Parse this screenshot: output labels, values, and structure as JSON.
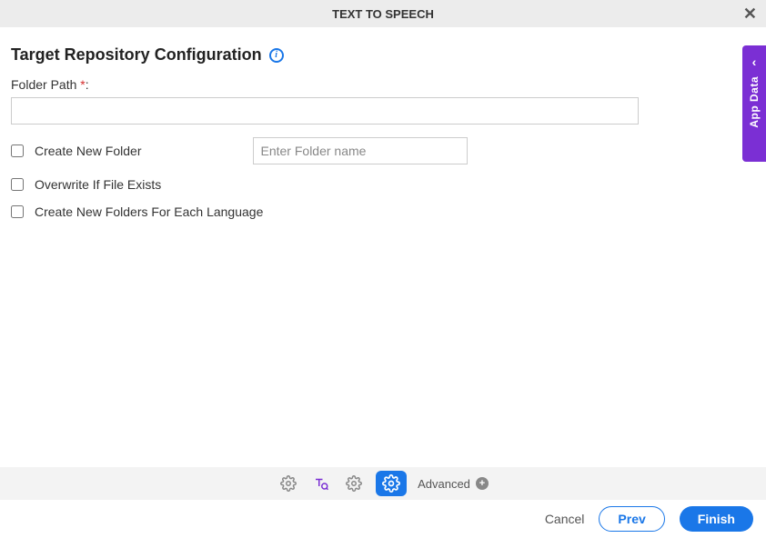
{
  "header": {
    "title": "TEXT TO SPEECH"
  },
  "section": {
    "title": "Target Repository Configuration",
    "folder_path_label": "Folder Path ",
    "required_mark": "*",
    "colon": ":",
    "folder_path_value": "",
    "create_new_folder_label": "Create New Folder",
    "folder_name_placeholder": "Enter Folder name",
    "folder_name_value": "",
    "overwrite_label": "Overwrite If File Exists",
    "per_language_label": "Create New Folders For Each Language"
  },
  "side": {
    "label": "App Data"
  },
  "steps": {
    "advanced_label": "Advanced"
  },
  "footer": {
    "cancel": "Cancel",
    "prev": "Prev",
    "finish": "Finish"
  },
  "colors": {
    "accent_blue": "#1a77e8",
    "accent_purple": "#7b2fd4"
  }
}
